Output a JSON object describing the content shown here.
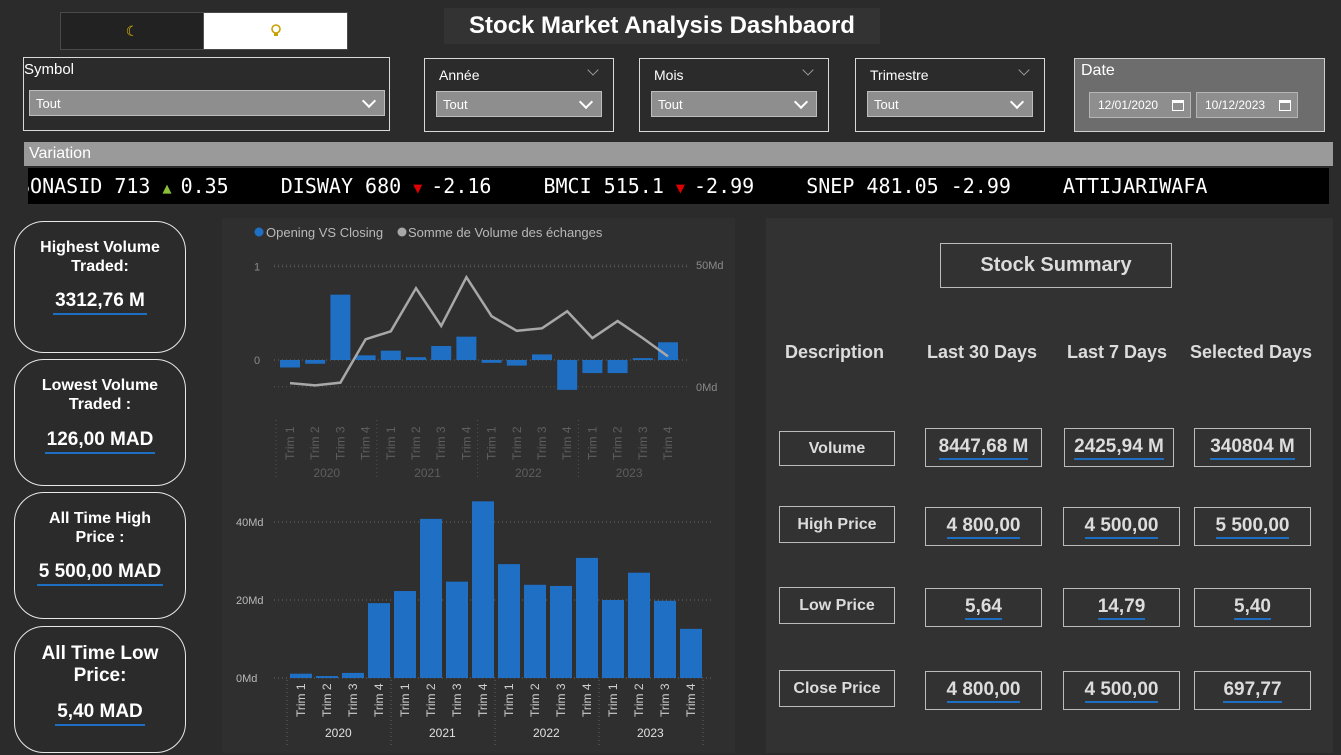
{
  "theme_toggle": {
    "dark_icon": "☾",
    "light_icon": "💡"
  },
  "title": "Stock Market Analysis Dashbaord",
  "slicers": {
    "symbol": {
      "label": "Symbol",
      "value": "Tout"
    },
    "annee": {
      "label": "Année",
      "value": "Tout"
    },
    "mois": {
      "label": "Mois",
      "value": "Tout"
    },
    "trimestre": {
      "label": "Trimestre",
      "value": "Tout"
    },
    "date": {
      "label": "Date",
      "start": "12/01/2020",
      "end": "10/12/2023"
    }
  },
  "variation": {
    "label": "Variation",
    "items": [
      {
        "symbol": "SONASID",
        "price": "713",
        "dir": "up",
        "change": "0.35"
      },
      {
        "symbol": "DISWAY",
        "price": "680",
        "dir": "down",
        "change": "-2.16"
      },
      {
        "symbol": "BMCI",
        "price": "515.1",
        "dir": "down",
        "change": "-2.99"
      },
      {
        "symbol": "SNEP",
        "price": "481.05",
        "dir": "none",
        "change": "-2.99"
      },
      {
        "symbol": "ATTIJARIWAFA",
        "price": "",
        "dir": "none",
        "change": ""
      }
    ],
    "arrows": {
      "up": "▲",
      "down": "▼"
    }
  },
  "kpis": {
    "highest_volume": {
      "label": "Highest Volume Traded:",
      "value": "3312,76 M"
    },
    "lowest_volume": {
      "label": "Lowest Volume Traded :",
      "value": "126,00 MAD"
    },
    "all_time_high": {
      "label": "All Time High Price :",
      "value": "5 500,00 MAD"
    },
    "all_time_low": {
      "label": "All Time Low Price:",
      "value": "5,40 MAD"
    }
  },
  "chart_data": [
    {
      "type": "bar",
      "title": "",
      "legend": [
        "Opening VS Closing",
        "Somme de Volume des échanges"
      ],
      "legend_position": "top-left",
      "colors": {
        "bar": "#1f6fc5",
        "line": "#a8a8a8"
      },
      "categories": [
        "Trim 1",
        "Trim 2",
        "Trim 3",
        "Trim 4",
        "Trim 1",
        "Trim 2",
        "Trim 3",
        "Trim 4",
        "Trim 1",
        "Trim 2",
        "Trim 3",
        "Trim 4",
        "Trim 1",
        "Trim 2",
        "Trim 3",
        "Trim 4"
      ],
      "groups": [
        {
          "label": "2020",
          "span": 4
        },
        {
          "label": "2021",
          "span": 4
        },
        {
          "label": "2022",
          "span": 4
        },
        {
          "label": "2023",
          "span": 4
        }
      ],
      "series": [
        {
          "name": "Opening VS Closing",
          "kind": "bar",
          "values": [
            -0.08,
            -0.04,
            0.7,
            0.05,
            0.1,
            0.03,
            0.15,
            0.25,
            -0.03,
            -0.06,
            0.06,
            -0.32,
            -0.14,
            -0.14,
            0.02,
            0.19
          ]
        },
        {
          "name": "Somme de Volume des échanges",
          "kind": "line",
          "values": [
            1.5,
            0.6,
            1.7,
            19.5,
            22.8,
            40.5,
            25,
            45,
            29,
            23,
            24,
            31,
            20,
            27,
            20,
            12.5
          ]
        }
      ],
      "y_left": {
        "ticks": [
          "1",
          "0"
        ],
        "range": [
          -0.6,
          1.2
        ]
      },
      "y_right": {
        "ticks": [
          "50Md",
          "0Md"
        ],
        "range": [
          -12,
          57
        ]
      },
      "grid": true
    },
    {
      "type": "bar",
      "title": "",
      "colors": {
        "bar": "#1f6fc5"
      },
      "categories": [
        "Trim 1",
        "Trim 2",
        "Trim 3",
        "Trim 4",
        "Trim 1",
        "Trim 2",
        "Trim 3",
        "Trim 4",
        "Trim 1",
        "Trim 2",
        "Trim 3",
        "Trim 4",
        "Trim 1",
        "Trim 2",
        "Trim 3",
        "Trim 4"
      ],
      "groups": [
        {
          "label": "2020",
          "span": 4
        },
        {
          "label": "2021",
          "span": 4
        },
        {
          "label": "2022",
          "span": 4
        },
        {
          "label": "2023",
          "span": 4
        }
      ],
      "series": [
        {
          "name": "",
          "values": [
            1.1,
            0.5,
            1.3,
            19.2,
            22.3,
            40.8,
            24.7,
            45.3,
            29.2,
            23.9,
            23.6,
            30.8,
            20,
            27,
            19.8,
            12.6
          ]
        }
      ],
      "ylim": [
        0,
        50
      ],
      "y_ticks": [
        "40Md",
        "20Md",
        "0Md"
      ],
      "grid": true
    }
  ],
  "summary": {
    "title": "Stock Summary",
    "headers": [
      "Description",
      "Last 30 Days",
      "Last 7 Days",
      "Selected Days"
    ],
    "rows": [
      {
        "label": "Volume",
        "values": [
          "8447,68 M",
          "2425,94 M",
          "340804 M"
        ]
      },
      {
        "label": "High Price",
        "values": [
          "4 800,00",
          "4 500,00",
          "5 500,00"
        ]
      },
      {
        "label": "Low Price",
        "values": [
          "5,64",
          "14,79",
          "5,40"
        ]
      },
      {
        "label": "Close Price",
        "values": [
          "4 800,00",
          "4 500,00",
          "697,77"
        ]
      }
    ]
  }
}
